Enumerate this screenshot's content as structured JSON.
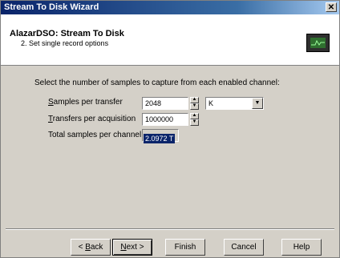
{
  "window": {
    "title": "Stream To Disk Wizard",
    "close_glyph": "✕"
  },
  "header": {
    "title": "AlazarDSO: Stream To Disk",
    "subtitle": "2. Set single record options",
    "icon": "oscilloscope-icon"
  },
  "main": {
    "instruction": "Select the number of samples to capture from each enabled channel:",
    "samples_per_transfer": {
      "label_accel": "S",
      "label_rest": "amples per transfer",
      "value": "2048",
      "unit": "K"
    },
    "transfers_per_acquisition": {
      "label_accel": "T",
      "label_rest": "ransfers per acquisition",
      "value": "1000000"
    },
    "total_samples": {
      "label": "Total samples per channel",
      "value": "2.0972 T"
    }
  },
  "buttons": {
    "back": {
      "prefix": "< ",
      "accel": "B",
      "rest": "ack"
    },
    "next": {
      "accel": "N",
      "rest": "ext >"
    },
    "finish": "Finish",
    "cancel": "Cancel",
    "help": "Help"
  },
  "colors": {
    "title_bar": "#0a246a",
    "dialog_face": "#d4d0c8",
    "selection": "#0a246a"
  }
}
